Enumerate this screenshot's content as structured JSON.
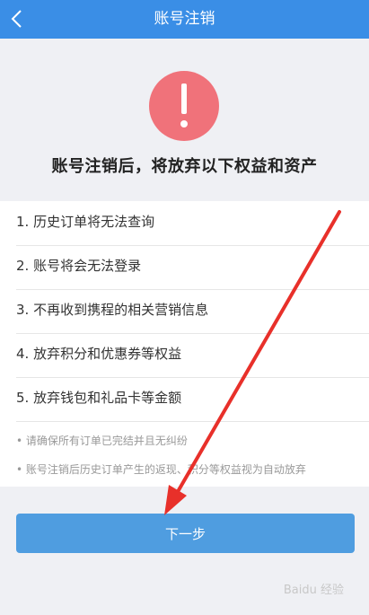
{
  "nav": {
    "title": "账号注销"
  },
  "hero": {
    "heading": "账号注销后，将放弃以下权益和资产"
  },
  "items": [
    "1. 历史订单将无法查询",
    "2. 账号将会无法登录",
    "3. 不再收到携程的相关营销信息",
    "4. 放弃积分和优惠券等权益",
    "5. 放弃钱包和礼品卡等金额"
  ],
  "notes": [
    "• 请确保所有订单已完结并且无纠纷",
    "• 账号注销后历史订单产生的返现、积分等权益视为自动放弃"
  ],
  "button": {
    "label": "下一步"
  },
  "colors": {
    "nav": "#3a8ee6",
    "alert": "#f0727a",
    "button": "#4f9de0",
    "arrow": "#e8302a"
  },
  "watermark": "Baidu 经验"
}
